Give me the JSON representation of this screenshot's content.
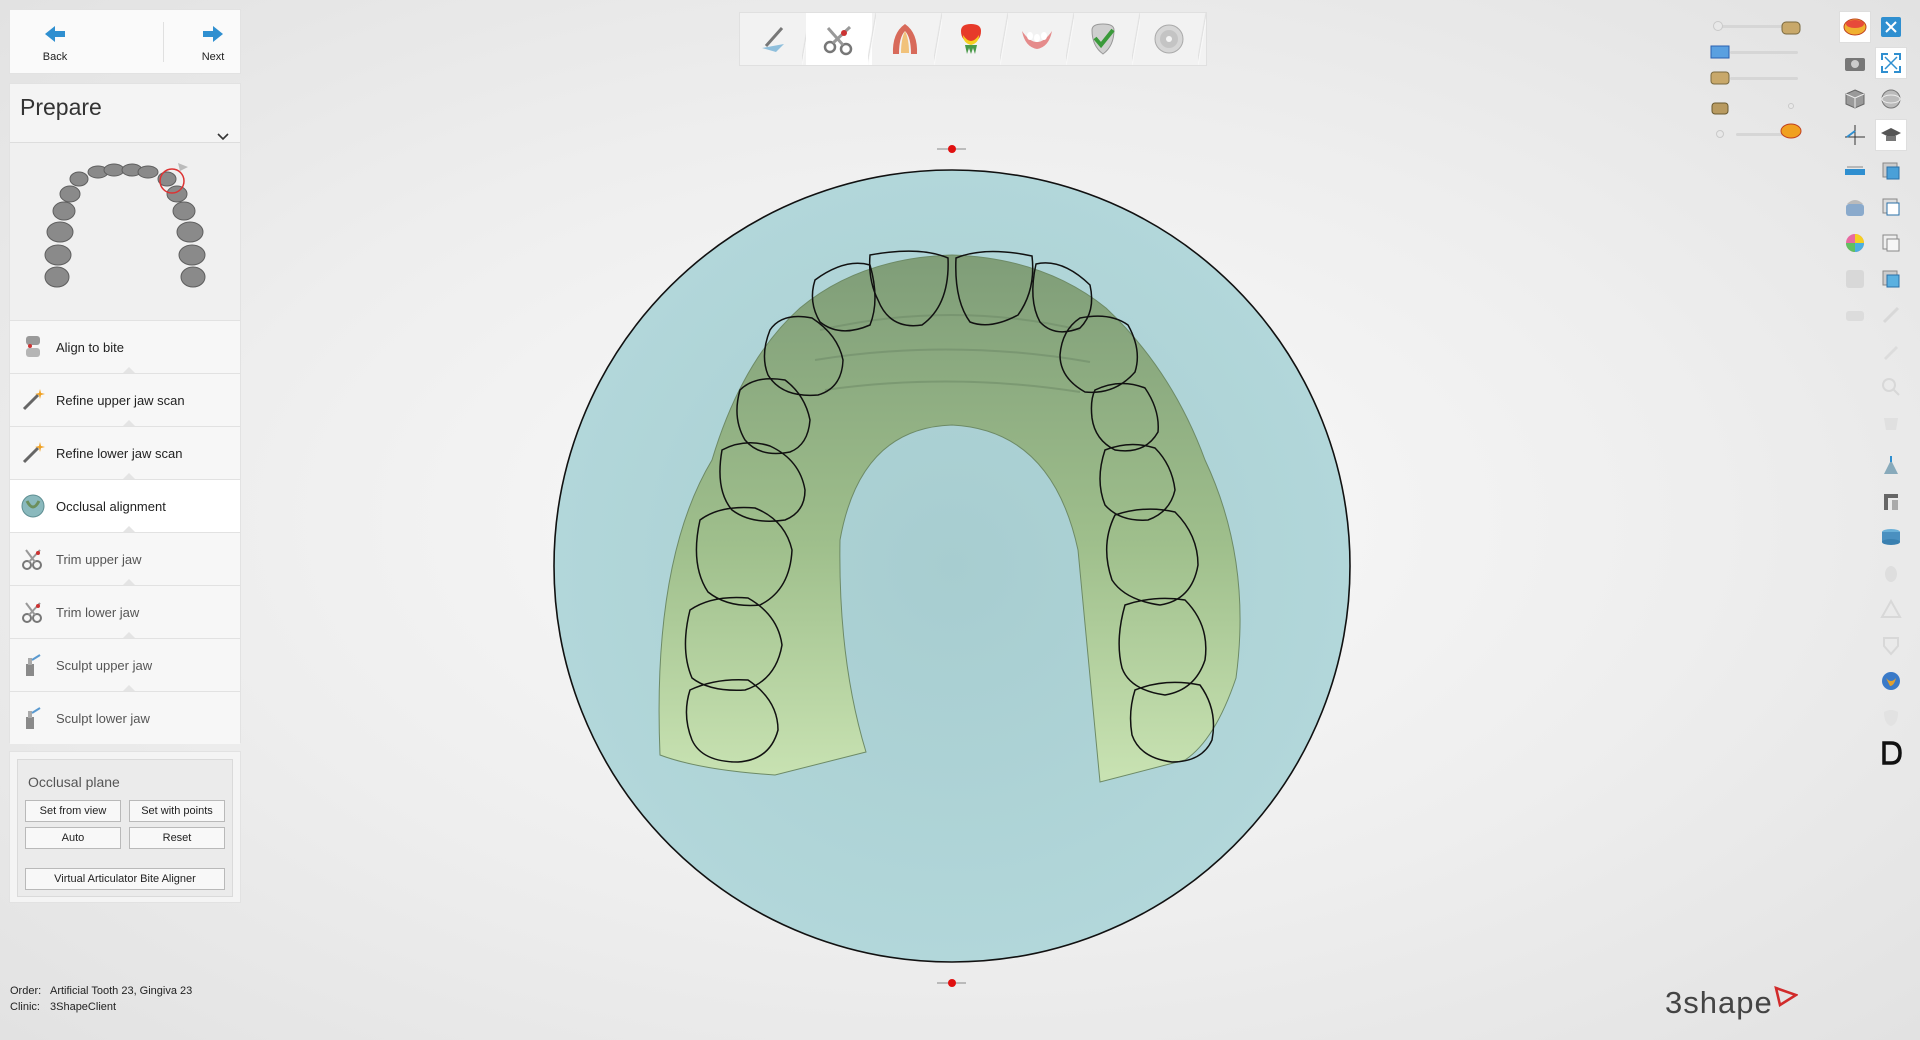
{
  "nav": {
    "back_label": "Back",
    "next_label": "Next"
  },
  "prepare": {
    "title": "Prepare",
    "steps": [
      {
        "label": "Align to bite",
        "icon": "align-bite-icon"
      },
      {
        "label": "Refine upper jaw scan",
        "icon": "magic-wand-icon"
      },
      {
        "label": "Refine lower jaw scan",
        "icon": "magic-wand-icon"
      },
      {
        "label": "Occlusal alignment",
        "icon": "occlusal-disc-icon"
      },
      {
        "label": "Trim upper jaw",
        "icon": "scissors-icon"
      },
      {
        "label": "Trim lower jaw",
        "icon": "scissors-icon"
      },
      {
        "label": "Sculpt upper jaw",
        "icon": "sculpt-tool-icon"
      },
      {
        "label": "Sculpt lower jaw",
        "icon": "sculpt-tool-icon"
      }
    ],
    "active_step": "Occlusal alignment"
  },
  "occlusal_plane": {
    "title": "Occlusal plane",
    "set_from_view": "Set from view",
    "set_with_points": "Set with points",
    "auto": "Auto",
    "reset": "Reset",
    "virtual_articulator": "Virtual Articulator Bite Aligner"
  },
  "toolbar": {
    "items": [
      "pen-icon",
      "scissors-tool-icon",
      "jaw-arch-icon",
      "color-tooth-icon",
      "gingiva-icon",
      "tooth-check-icon",
      "disc-icon"
    ],
    "active": "scissors-tool-icon"
  },
  "order": {
    "order_key": "Order:",
    "order_value": "Artificial Tooth 23, Gingiva 23",
    "clinic_key": "Clinic:",
    "clinic_value": "3ShapeClient"
  },
  "logo": "3shape",
  "colors": {
    "disc": "#aad2d4",
    "jaw_model": "#b9d6a3",
    "accent_blue": "#2f8fd0",
    "marker_red": "#e01010"
  }
}
